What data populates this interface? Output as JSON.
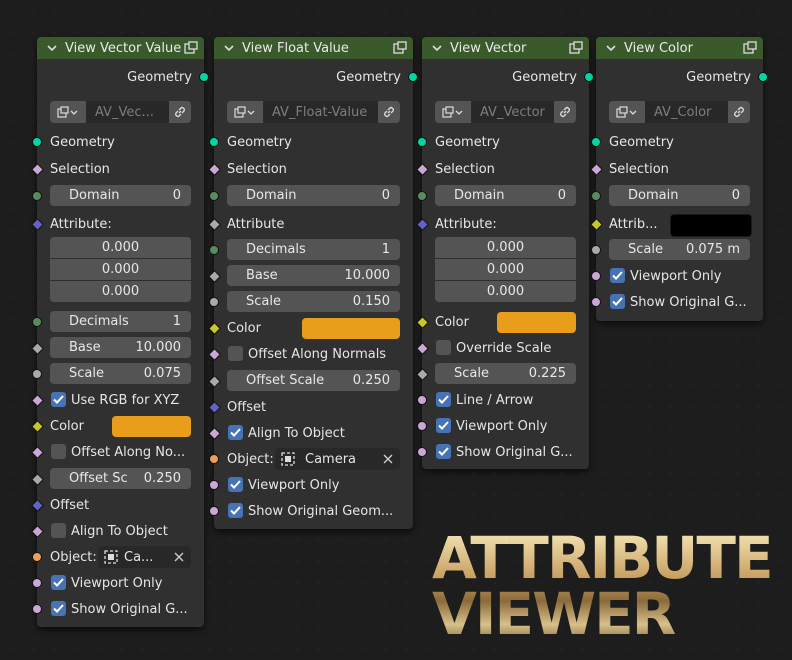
{
  "nodes": [
    {
      "title": "View Vector Value",
      "geometry_out": "Geometry",
      "db_name": "AV_Vec...",
      "geometry_in": "Geometry",
      "selection": "Selection",
      "domain_label": "Domain",
      "domain_value": "0",
      "attribute_label": "Attribute:",
      "attribute_values": [
        "0.000",
        "0.000",
        "0.000"
      ],
      "decimals_label": "Decimals",
      "decimals_value": "1",
      "base_label": "Base",
      "base_value": "10.000",
      "scale_label": "Scale",
      "scale_value": "0.075",
      "use_rgb_label": "Use RGB for XYZ",
      "color_label": "Color",
      "color_value": "#e89d1b",
      "offset_normals_label": "Offset Along No...",
      "offset_scale_label": "Offset Sc",
      "offset_scale_value": "0.250",
      "offset_label": "Offset",
      "align_label": "Align To Object",
      "object_label": "Object:",
      "object_value": "Ca...",
      "viewport_only_label": "Viewport Only",
      "show_original_label": "Show Original G..."
    },
    {
      "title": "View Float Value",
      "geometry_out": "Geometry",
      "db_name": "AV_Float-Value",
      "geometry_in": "Geometry",
      "selection": "Selection",
      "domain_label": "Domain",
      "domain_value": "0",
      "attribute_label": "Attribute",
      "decimals_label": "Decimals",
      "decimals_value": "1",
      "base_label": "Base",
      "base_value": "10.000",
      "scale_label": "Scale",
      "scale_value": "0.150",
      "color_label": "Color",
      "color_value": "#e89d1b",
      "offset_normals_label": "Offset Along Normals",
      "offset_scale_label": "Offset Scale",
      "offset_scale_value": "0.250",
      "offset_label": "Offset",
      "align_label": "Align To Object",
      "object_label": "Object:",
      "object_value": "Camera",
      "viewport_only_label": "Viewport Only",
      "show_original_label": "Show Original Geom..."
    },
    {
      "title": "View Vector",
      "geometry_out": "Geometry",
      "db_name": "AV_Vector",
      "geometry_in": "Geometry",
      "selection": "Selection",
      "domain_label": "Domain",
      "domain_value": "0",
      "attribute_label": "Attribute:",
      "attribute_values": [
        "0.000",
        "0.000",
        "0.000"
      ],
      "color_label": "Color",
      "color_value": "#e89d1b",
      "override_scale_label": "Override Scale",
      "scale_label": "Scale",
      "scale_value": "0.225",
      "line_arrow_label": "Line / Arrow",
      "viewport_only_label": "Viewport Only",
      "show_original_label": "Show Original G..."
    },
    {
      "title": "View Color",
      "geometry_out": "Geometry",
      "db_name": "AV_Color",
      "geometry_in": "Geometry",
      "selection": "Selection",
      "domain_label": "Domain",
      "domain_value": "0",
      "attribute_label": "Attrib...",
      "attribute_color": "#000000",
      "scale_label": "Scale",
      "scale_value": "0.075 m",
      "viewport_only_label": "Viewport Only",
      "show_original_label": "Show Original G..."
    }
  ],
  "logo": {
    "line1": "ATTRIBUTE",
    "line2": "VIEWER"
  },
  "colors": {
    "header": "#3b5a2c",
    "geometry_socket": "#00d6a3",
    "field_socket": "#a9a9a9",
    "int_socket": "#598c5c",
    "vector_socket": "#6363c7",
    "bool_socket": "#cca6d6",
    "color_socket": "#c7c729",
    "object_socket": "#ed9e5c",
    "checkbox_on": "#4772b3"
  },
  "icons": [
    "chevron-down-icon",
    "node-group-icon",
    "link-icon",
    "object-icon",
    "close-icon",
    "checkmark-icon"
  ]
}
